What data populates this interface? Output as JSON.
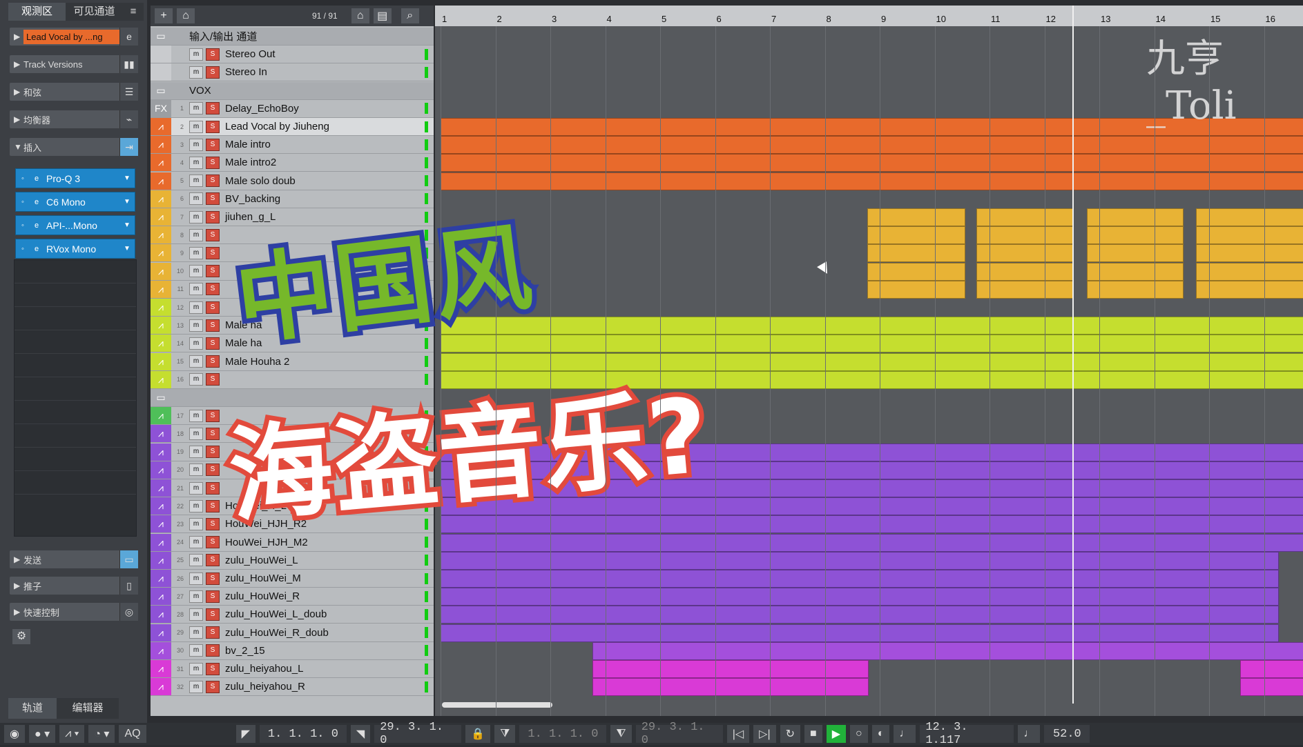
{
  "inspector": {
    "tabs": [
      "观测区",
      "可见通道"
    ],
    "menu_icon": "menu-icon",
    "track_name": "Lead Vocal by ...ng",
    "sections": [
      {
        "label": "Track Versions",
        "icon": "track-versions-icon"
      },
      {
        "label": "和弦",
        "icon": "chord-icon"
      },
      {
        "label": "均衡器",
        "icon": "eq-icon"
      },
      {
        "label": "插入",
        "icon": "insert-icon"
      }
    ],
    "inserts": [
      "Pro-Q 3",
      "C6 Mono",
      "API-...Mono",
      "RVox Mono"
    ],
    "lower_sections": [
      {
        "label": "发送",
        "icon": "send-icon"
      },
      {
        "label": "推子",
        "icon": "fader-icon"
      },
      {
        "label": "快速控制",
        "icon": "quick-control-icon"
      }
    ],
    "bottom_tabs": [
      "轨道",
      "编辑器"
    ]
  },
  "toolbar": {
    "counter": "91 / 91"
  },
  "tracks": [
    {
      "num": "",
      "name": "输入/输出 通道",
      "type": "folder"
    },
    {
      "num": "",
      "name": "Stereo Out",
      "type": "io",
      "color": "#c9cbce"
    },
    {
      "num": "",
      "name": "Stereo In",
      "type": "io",
      "color": "#c9cbce"
    },
    {
      "num": "",
      "name": "VOX",
      "type": "folder"
    },
    {
      "num": "1",
      "name": "Delay_EchoBoy",
      "type": "fx",
      "color": "#9b9ea2"
    },
    {
      "num": "2",
      "name": "Lead Vocal by Jiuheng",
      "type": "audio",
      "color": "#e86a2c",
      "selected": true
    },
    {
      "num": "3",
      "name": "Male intro",
      "type": "audio",
      "color": "#e86a2c"
    },
    {
      "num": "4",
      "name": "Male intro2",
      "type": "audio",
      "color": "#e86a2c"
    },
    {
      "num": "5",
      "name": "Male solo doub",
      "type": "audio",
      "color": "#e86a2c"
    },
    {
      "num": "6",
      "name": "BV_backing",
      "type": "group",
      "color": "#e8b335"
    },
    {
      "num": "7",
      "name": "jiuhen_g_L",
      "type": "audio",
      "color": "#e8b335"
    },
    {
      "num": "8",
      "name": "",
      "type": "audio",
      "color": "#e8b335"
    },
    {
      "num": "9",
      "name": "",
      "type": "audio",
      "color": "#e8b335"
    },
    {
      "num": "10",
      "name": "",
      "type": "audio",
      "color": "#e8b335"
    },
    {
      "num": "11",
      "name": "",
      "type": "audio",
      "color": "#e8b335"
    },
    {
      "num": "12",
      "name": "",
      "type": "group",
      "color": "#c5de2f"
    },
    {
      "num": "13",
      "name": "Male ha",
      "type": "audio",
      "color": "#c5de2f"
    },
    {
      "num": "14",
      "name": "Male ha",
      "type": "audio",
      "color": "#c5de2f"
    },
    {
      "num": "15",
      "name": "Male Houha 2",
      "type": "audio",
      "color": "#c5de2f"
    },
    {
      "num": "16",
      "name": "",
      "type": "audio",
      "color": "#c5de2f"
    },
    {
      "num": "",
      "name": "",
      "type": "folder"
    },
    {
      "num": "17",
      "name": "",
      "type": "group",
      "color": "#4fbf59"
    },
    {
      "num": "18",
      "name": "",
      "type": "group",
      "color": "#8e52d6"
    },
    {
      "num": "19",
      "name": "",
      "type": "audio",
      "color": "#8e52d6"
    },
    {
      "num": "20",
      "name": "",
      "type": "audio",
      "color": "#8e52d6"
    },
    {
      "num": "21",
      "name": "",
      "type": "audio",
      "color": "#8e52d6"
    },
    {
      "num": "22",
      "name": "HouWei_H_L",
      "type": "audio",
      "color": "#8e52d6"
    },
    {
      "num": "23",
      "name": "HouWei_HJH_R2",
      "type": "audio",
      "color": "#8e52d6"
    },
    {
      "num": "24",
      "name": "HouWei_HJH_M2",
      "type": "audio",
      "color": "#8e52d6"
    },
    {
      "num": "25",
      "name": "zulu_HouWei_L",
      "type": "audio",
      "color": "#8e52d6"
    },
    {
      "num": "26",
      "name": "zulu_HouWei_M",
      "type": "audio",
      "color": "#8e52d6"
    },
    {
      "num": "27",
      "name": "zulu_HouWei_R",
      "type": "audio",
      "color": "#8e52d6"
    },
    {
      "num": "28",
      "name": "zulu_HouWei_L_doub",
      "type": "audio",
      "color": "#8e52d6"
    },
    {
      "num": "29",
      "name": "zulu_HouWei_R_doub",
      "type": "audio",
      "color": "#8e52d6"
    },
    {
      "num": "30",
      "name": "bv_2_15",
      "type": "audio",
      "color": "#a44fdc"
    },
    {
      "num": "31",
      "name": "zulu_heiyahou_L",
      "type": "audio",
      "color": "#d93ad6"
    },
    {
      "num": "32",
      "name": "zulu_heiyahou_R",
      "type": "audio",
      "color": "#d93ad6"
    }
  ],
  "ruler": [
    "1",
    "2",
    "3",
    "4",
    "5",
    "6",
    "7",
    "8",
    "9",
    "10",
    "11",
    "12",
    "13",
    "14",
    "15",
    "16"
  ],
  "overlay": {
    "title1": "中国风",
    "title2": "海盗音乐?",
    "watermark": "九亨_Toli"
  },
  "transport": {
    "left_locator": "1. 1. 1.   0",
    "right_locator": "29. 3. 1.   0",
    "punch_in": "1. 1. 1.   0",
    "punch_out": "29. 3. 1.   0",
    "position": "12. 3. 1.117",
    "tempo": "52.0",
    "aq_label": "AQ"
  },
  "colors": {
    "orange": "#e86a2c",
    "yellow": "#e8b335",
    "lime": "#c5de2f",
    "purple": "#8e52d6",
    "magenta": "#d93ad6",
    "play_green": "#21b23a"
  }
}
